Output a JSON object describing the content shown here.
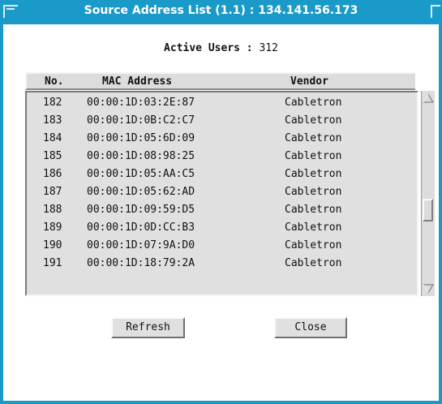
{
  "window": {
    "title": "Source Address List (1.1) : 134.141.56.173"
  },
  "summary": {
    "active_users_label": "Active Users :",
    "active_users_value": "312"
  },
  "table": {
    "headers": {
      "no": "No.",
      "mac": "MAC Address",
      "vendor": "Vendor"
    },
    "rows": [
      {
        "no": "182",
        "mac": "00:00:1D:03:2E:87",
        "vendor": "Cabletron"
      },
      {
        "no": "183",
        "mac": "00:00:1D:0B:C2:C7",
        "vendor": "Cabletron"
      },
      {
        "no": "184",
        "mac": "00:00:1D:05:6D:09",
        "vendor": "Cabletron"
      },
      {
        "no": "185",
        "mac": "00:00:1D:08:98:25",
        "vendor": "Cabletron"
      },
      {
        "no": "186",
        "mac": "00:00:1D:05:AA:C5",
        "vendor": "Cabletron"
      },
      {
        "no": "187",
        "mac": "00:00:1D:05:62:AD",
        "vendor": "Cabletron"
      },
      {
        "no": "188",
        "mac": "00:00:1D:09:59:D5",
        "vendor": "Cabletron"
      },
      {
        "no": "189",
        "mac": "00:00:1D:0D:CC:B3",
        "vendor": "Cabletron"
      },
      {
        "no": "190",
        "mac": "00:00:1D:07:9A:D0",
        "vendor": "Cabletron"
      },
      {
        "no": "191",
        "mac": "00:00:1D:18:79:2A",
        "vendor": "Cabletron"
      }
    ]
  },
  "buttons": {
    "refresh": "Refresh",
    "close": "Close"
  },
  "icons": {
    "window_menu": "window-menu-icon",
    "maximize": "maximize-icon",
    "scroll_up": "scroll-up-arrow-icon",
    "scroll_down": "scroll-down-arrow-icon"
  },
  "colors": {
    "titlebar": "#1a9ac8",
    "panel": "#e0e0e0"
  }
}
